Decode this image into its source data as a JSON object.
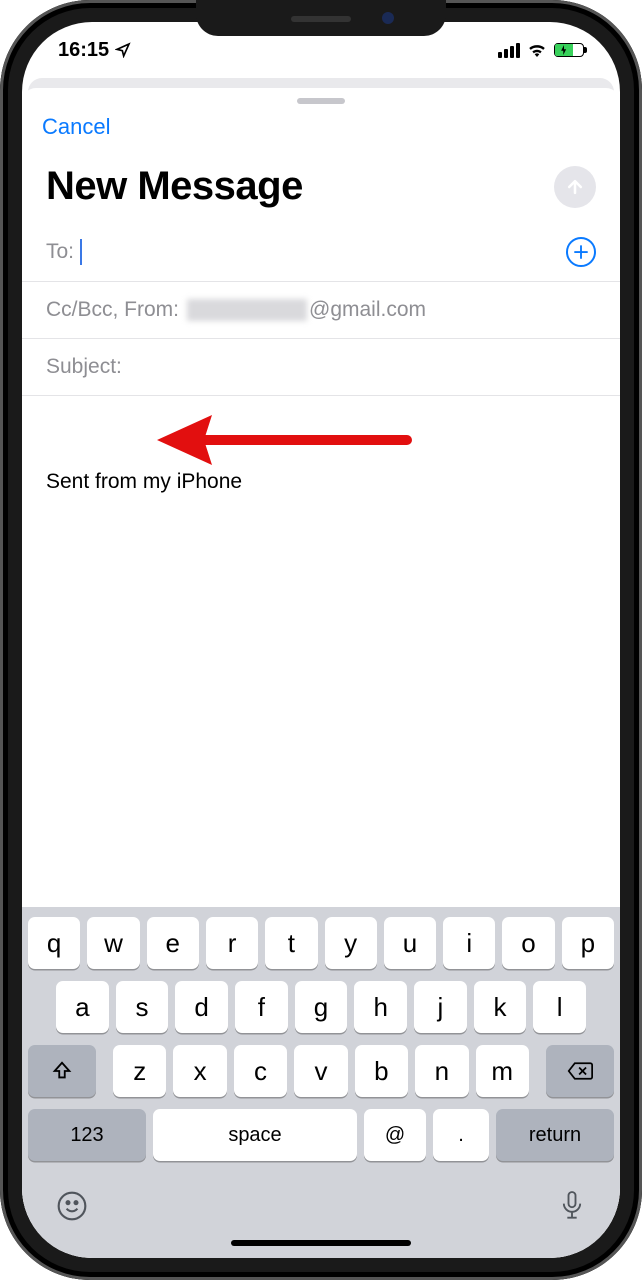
{
  "status": {
    "time": "16:15"
  },
  "compose": {
    "cancel": "Cancel",
    "title": "New Message",
    "to_label": "To:",
    "ccbcc_from_label": "Cc/Bcc, From:",
    "from_email_suffix": "@gmail.com",
    "subject_label": "Subject:",
    "signature": "Sent from my iPhone"
  },
  "keyboard": {
    "row1": [
      "q",
      "w",
      "e",
      "r",
      "t",
      "y",
      "u",
      "i",
      "o",
      "p"
    ],
    "row2": [
      "a",
      "s",
      "d",
      "f",
      "g",
      "h",
      "j",
      "k",
      "l"
    ],
    "row3": [
      "z",
      "x",
      "c",
      "v",
      "b",
      "n",
      "m"
    ],
    "num_key": "123",
    "space_key": "space",
    "at_key": "@",
    "dot_key": ".",
    "return_key": "return"
  }
}
